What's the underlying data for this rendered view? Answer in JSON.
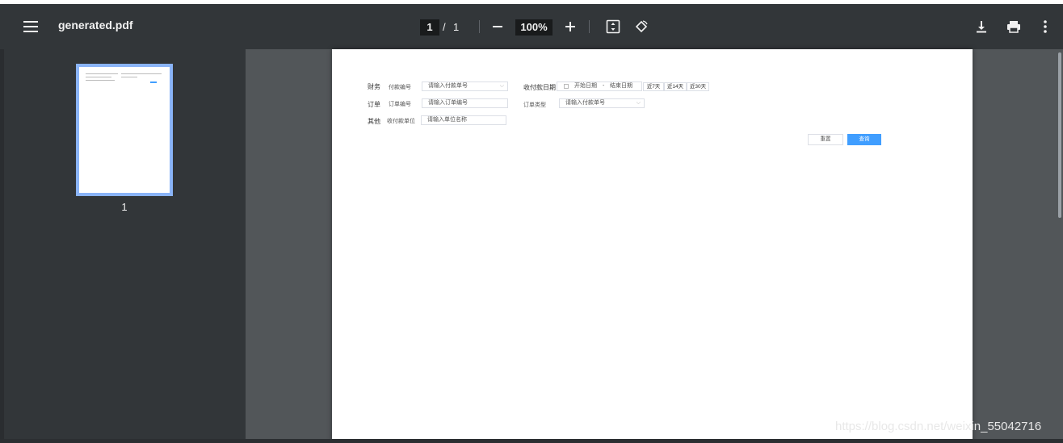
{
  "toolbar": {
    "title": "generated.pdf",
    "page_current": "1",
    "page_separator": "/",
    "page_total": "1",
    "zoom": "100%",
    "icons": [
      "menu-icon",
      "zoom-out-icon",
      "zoom-in-icon",
      "fit-page-icon",
      "rotate-icon",
      "download-icon",
      "print-icon",
      "more-vert-icon"
    ]
  },
  "sidebar": {
    "thumbnail_label": "1"
  },
  "form": {
    "row1": {
      "group": "财务",
      "field_label": "付款编号",
      "field_placeholder": "请输入付款单号",
      "date_label": "收付款日期",
      "start_placeholder": "开始日期",
      "range_sep": "-",
      "end_placeholder": "结束日期",
      "quick": [
        "近7天",
        "近14天",
        "近30天"
      ]
    },
    "row2": {
      "group": "订单",
      "field_label": "订单编号",
      "field_placeholder": "请输入订单编号",
      "type_label": "订单类型",
      "type_placeholder": "请输入付款单号"
    },
    "row3": {
      "group": "其他",
      "field_label": "收付款单位",
      "field_placeholder": "请输入单位名称"
    },
    "reset_label": "重置",
    "query_label": "查询"
  },
  "watermark": "https://blog.csdn.net/weixin_55042716",
  "colors": {
    "toolbar_bg": "#323639",
    "viewer_bg": "#525659",
    "thumb_border": "#8ab4f8",
    "primary": "#409eff"
  }
}
